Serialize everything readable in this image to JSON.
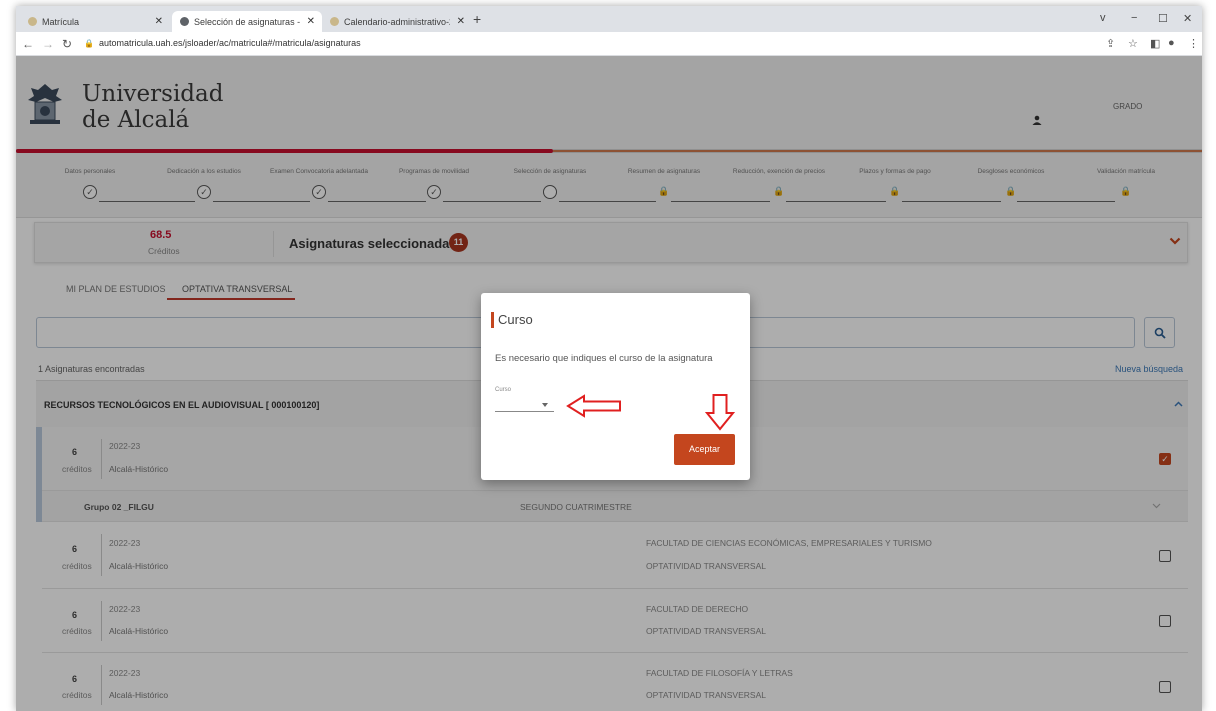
{
  "browser": {
    "tabs": [
      {
        "title": "Matrícula",
        "active": false
      },
      {
        "title": "Selección de asignaturas - Univer",
        "active": true
      },
      {
        "title": "Calendario-administrativo-22-23",
        "active": false
      }
    ],
    "new_tab": "+",
    "url": "automatricula.uah.es/jsloader/ac/matricula#/matricula/asignaturas",
    "window_controls": [
      "v",
      "−",
      "☐",
      "✕"
    ]
  },
  "header": {
    "name_line1": "Universidad",
    "name_line2": "de Alcalá",
    "level": "GRADO"
  },
  "stepper": {
    "steps": [
      {
        "label": "Datos personales",
        "state": "done"
      },
      {
        "label": "Dedicación a los estudios",
        "state": "done"
      },
      {
        "label": "Examen Convocatoria adelantada",
        "state": "done"
      },
      {
        "label": "Programas de movilidad",
        "state": "done"
      },
      {
        "label": "Selección de asignaturas",
        "state": "current"
      },
      {
        "label": "Resumen de asignaturas",
        "state": "locked"
      },
      {
        "label": "Reducción, exención de precios",
        "state": "locked"
      },
      {
        "label": "Plazos y formas de pago",
        "state": "locked"
      },
      {
        "label": "Desgloses económicos",
        "state": "locked"
      },
      {
        "label": "Validación matrícula",
        "state": "locked"
      }
    ]
  },
  "summary": {
    "credits": "68.5",
    "credits_label": "Créditos",
    "title": "Asignaturas seleccionadas",
    "count": "11"
  },
  "plan_tabs": [
    "MI PLAN DE ESTUDIOS",
    "OPTATIVA TRANSVERSAL"
  ],
  "search": {
    "value": "",
    "results_count": "1 Asignaturas encontradas",
    "new_search": "Nueva búsqueda"
  },
  "result": {
    "subject": "RECURSOS TECNOLÓGICOS EN EL AUDIOVISUAL [ 000100120]",
    "rows": [
      {
        "credits": "6",
        "credits_label": "créditos",
        "year": "2022-23",
        "campus": "Alcalá-Histórico",
        "faculty": "",
        "optativity": "",
        "checked": true
      },
      {
        "credits": "6",
        "credits_label": "créditos",
        "year": "2022-23",
        "campus": "Alcalá-Histórico",
        "faculty": "FACULTAD DE CIENCIAS ECONÓMICAS, EMPRESARIALES Y TURISMO",
        "optativity": "OPTATIVIDAD TRANSVERSAL",
        "checked": false
      },
      {
        "credits": "6",
        "credits_label": "créditos",
        "year": "2022-23",
        "campus": "Alcalá-Histórico",
        "faculty": "FACULTAD DE DERECHO",
        "optativity": "OPTATIVIDAD TRANSVERSAL",
        "checked": false
      },
      {
        "credits": "6",
        "credits_label": "créditos",
        "year": "2022-23",
        "campus": "Alcalá-Histórico",
        "faculty": "FACULTAD DE FILOSOFÍA Y LETRAS",
        "optativity": "OPTATIVIDAD TRANSVERSAL",
        "checked": false
      }
    ],
    "group": {
      "name": "Grupo 02 _FILGU",
      "semester": "SEGUNDO CUATRIMESTRE"
    }
  },
  "modal": {
    "title": "Curso",
    "message": "Es necesario que indiques el curso de la asignatura",
    "field_label": "Curso",
    "selected": "",
    "accept": "Aceptar"
  },
  "colors": {
    "accent": "#c4461e",
    "brand_red": "#c8102e",
    "annotation_arrow": "#e02020"
  }
}
